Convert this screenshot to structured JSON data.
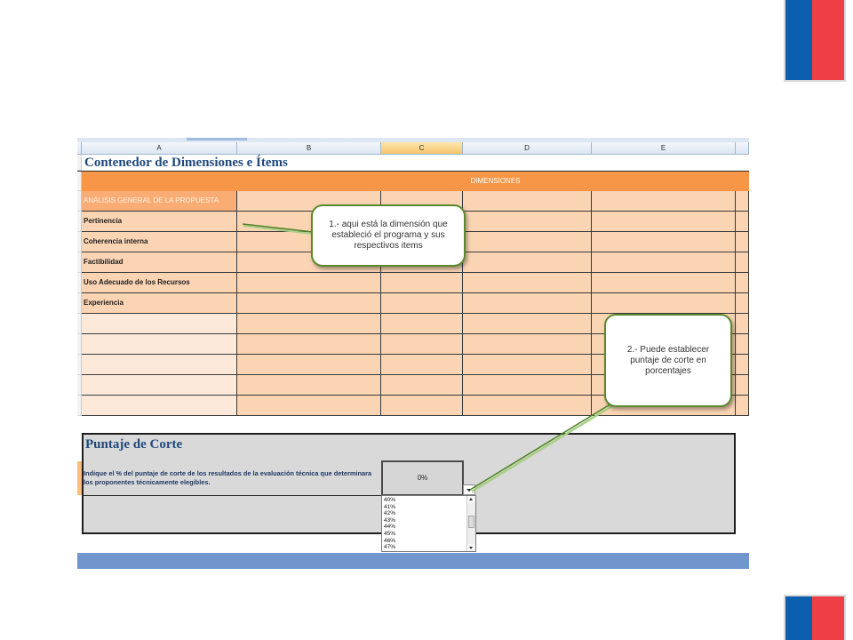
{
  "slide": {
    "flag_colors": {
      "blue": "#0b5fae",
      "red": "#ee3f47"
    }
  },
  "spreadsheet": {
    "column_headers": [
      "A",
      "B",
      "C",
      "D",
      "E"
    ],
    "selected_column": "C",
    "title": "Contenedor de Dimensiones e Ítems",
    "dimensions_header": "DIMENSIONES",
    "section_label": "ANÁLISIS GENERAL DE LA PROPUESTA",
    "dimension_rows": [
      "Pertinencia",
      "Coherencia interna",
      "Factibilidad",
      "Uso Adecuado de los Recursos",
      "Experiencia"
    ],
    "cutoff": {
      "title": "Puntaje de Corte",
      "instruction": "Indique el % del puntaje de corte de los resultados de la evaluación técnica que determinara los proponentes técnicamente elegibles.",
      "value": "0%",
      "dropdown_open": true,
      "options": [
        "40%",
        "41%",
        "42%",
        "43%",
        "44%",
        "45%",
        "46%",
        "47%"
      ]
    }
  },
  "callouts": [
    {
      "text": "1.- aqui está la dimensión que estableció el programa y sus respectivos items"
    },
    {
      "text": "2.- Puede establecer puntaje de corte en porcentajes"
    }
  ],
  "colors": {
    "dimensions_orange": "#f79646",
    "cell_peach": "#fbd4b4",
    "cell_light": "#fde9d9",
    "title_navy": "#1f497d",
    "callout_border": "#5a8a2c",
    "status_bar": "#7196ce"
  }
}
